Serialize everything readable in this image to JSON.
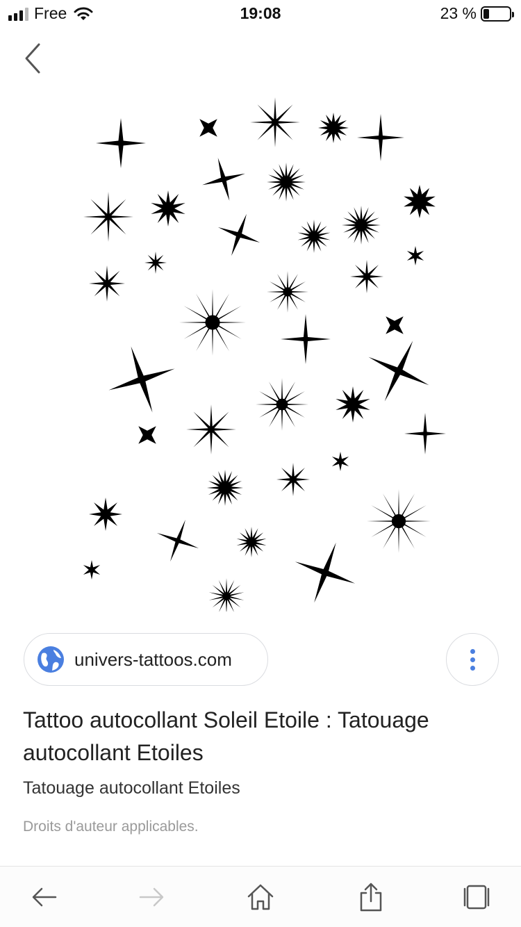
{
  "status_bar": {
    "carrier": "Free",
    "time": "19:08",
    "battery_percent": "23 %",
    "battery_level": 0.23
  },
  "result": {
    "source_domain": "univers-tattoos.com",
    "title": "Tattoo autocollant Soleil Etoile : Tatouage autocollant Etoiles",
    "subtitle": "Tatouage autocollant Etoiles",
    "copyright": "Droits d'auteur applicables."
  },
  "colors": {
    "accent": "#4a7fe0",
    "ink": "#000000",
    "muted_text": "#9a9a9a",
    "border": "#dadce0",
    "icon_gray": "#555555",
    "icon_disabled": "#c8c8c8"
  },
  "icons": {
    "back": "chevron-left-icon",
    "source": "globe-icon",
    "more": "more-vertical-icon",
    "toolbar": [
      "arrow-left-icon",
      "arrow-right-icon",
      "home-icon",
      "share-icon",
      "tabs-icon"
    ]
  }
}
